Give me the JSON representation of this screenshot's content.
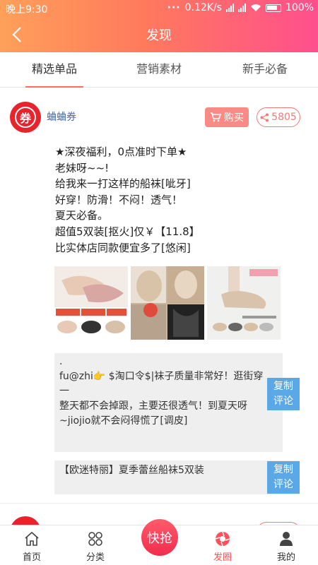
{
  "status_bar": {
    "time": "晚上9:30",
    "dots": "···",
    "speed": "0.12K/s",
    "battery": "100%"
  },
  "header": {
    "title": "发现"
  },
  "tabs": [
    {
      "label": "精选单品"
    },
    {
      "label": "营销素材"
    },
    {
      "label": "新手必备"
    }
  ],
  "post": {
    "avatar_text": "券",
    "author": "蛐蛐券",
    "buy_label": "购买",
    "share_count": "5805",
    "text_lines": [
      "★深夜福利，0点准时下单★",
      "老妹呀~~!",
      "给我来一打这样的船袜[呲牙]",
      "好穿！防滑！不闷！透气！",
      "夏天必备。",
      "超值5双装[抠火]仅￥【11.8】",
      "比实体店同款便宜多了[悠闲]"
    ],
    "images": [
      {
        "name": "lace-sock-product-image-1"
      },
      {
        "name": "lace-sock-product-image-2"
      },
      {
        "name": "lace-sock-product-image-3"
      }
    ],
    "comment_lines": [
      ".",
      "fu@zhi👉 $淘口令$|袜子质量非常好！逛街穿一",
      "整天都不会掉跟，主要还很透气！到夏天呀",
      "~jiojio就不会闷得慌了[调皮]"
    ],
    "copy_comment_line1": "复制",
    "copy_comment_line2": "评论",
    "product_title": "【欧迷特丽】夏季蕾丝船袜5双装",
    "copy_title_line1": "复制",
    "copy_title_line2": "评论"
  },
  "bottom_nav": {
    "items": [
      {
        "label": "首页",
        "icon": "home-icon"
      },
      {
        "label": "分类",
        "icon": "grid-icon"
      },
      {
        "label": "发圈",
        "icon": "aperture-icon"
      },
      {
        "label": "我的",
        "icon": "user-icon"
      }
    ],
    "center_button": "快抢"
  },
  "colors": {
    "accent": "#ff6f61",
    "header_start": "#ffa05a",
    "header_end": "#ff4f8e",
    "copy_button": "#5aa8e6",
    "avatar": "#e8232b"
  }
}
